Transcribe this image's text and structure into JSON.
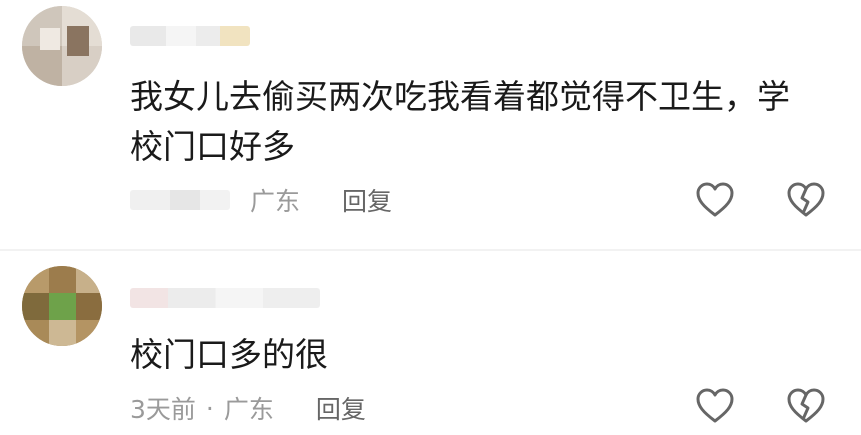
{
  "comments": [
    {
      "text_lines": [
        "我女儿去偷买两次吃我看着都觉得不卫生，学",
        "校门口好多"
      ],
      "region": "广东",
      "reply": "回复"
    },
    {
      "text_lines": [
        "校门口多的很"
      ],
      "time": "3天前",
      "separator": "·",
      "region": "广东",
      "reply": "回复"
    }
  ],
  "icons": {
    "like": "heart-outline-icon",
    "dislike": "broken-heart-outline-icon"
  }
}
